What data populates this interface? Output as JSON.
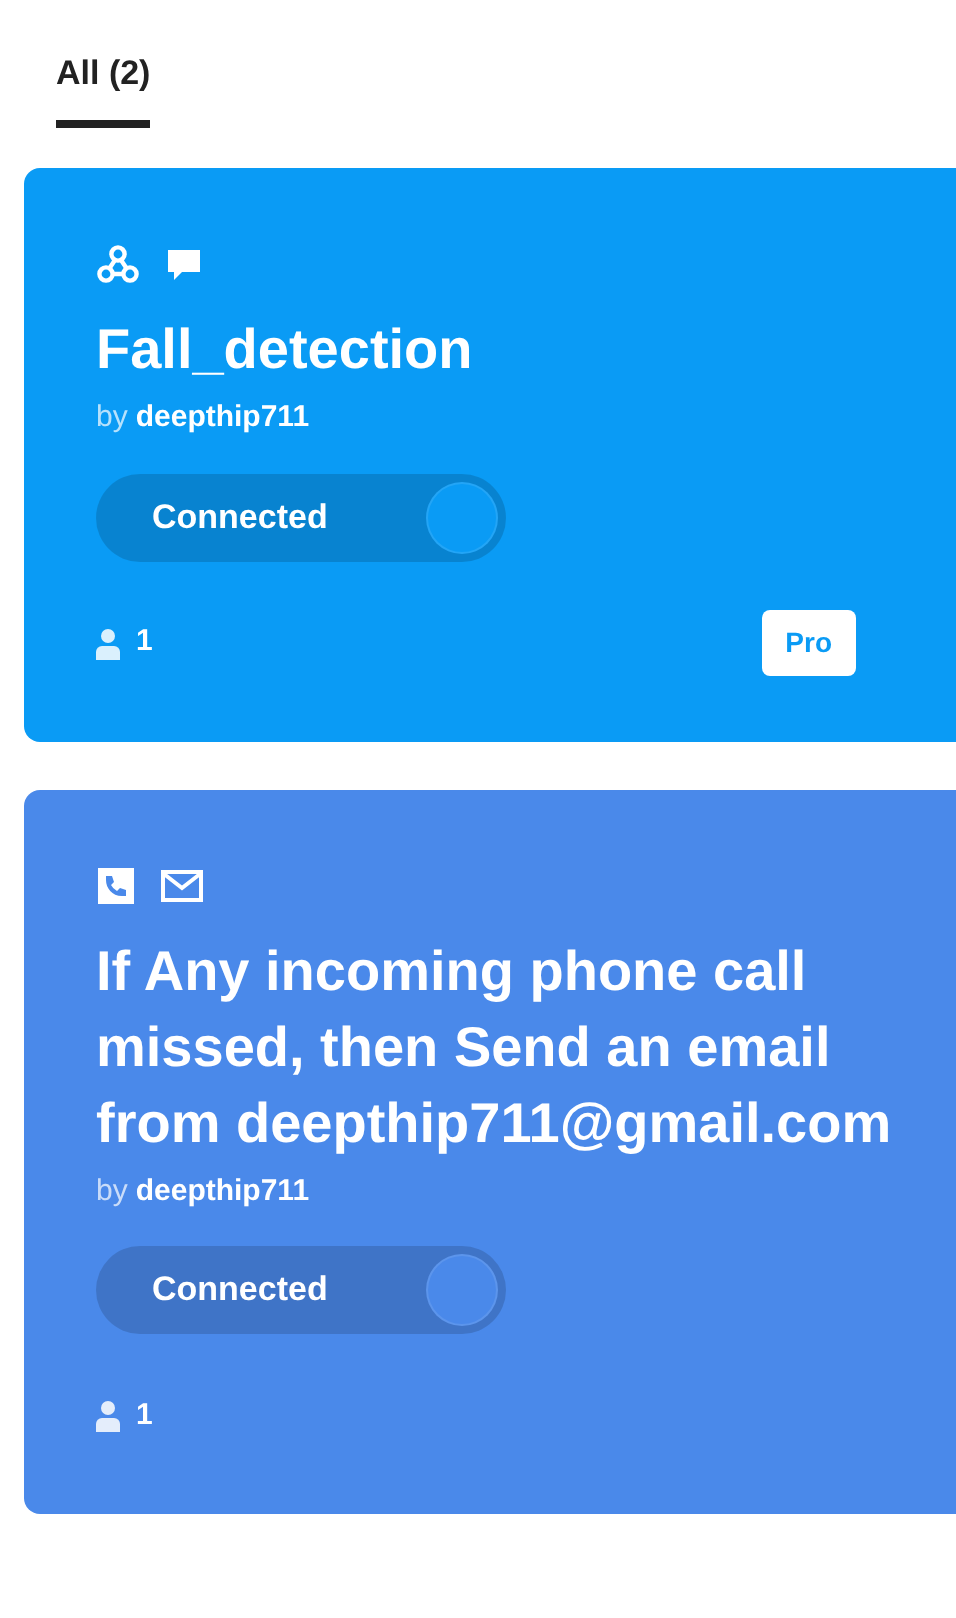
{
  "tabs": [
    {
      "label": "All (2)",
      "selected": true
    }
  ],
  "applets": [
    {
      "color": "#0a9bf5",
      "icons": [
        {
          "kind": "webhooks"
        },
        {
          "kind": "chat"
        }
      ],
      "title": "Fall_detection",
      "by": "by",
      "author": "deepthip711",
      "toggle": {
        "label": "Connected",
        "on": true
      },
      "users": "1",
      "badge": "Pro"
    },
    {
      "color": "#4a89ea",
      "icons": [
        {
          "kind": "phone"
        },
        {
          "kind": "mail"
        }
      ],
      "title": "If Any incoming phone call missed, then Send an email from deepthip711@gmail.com",
      "by": "by",
      "author": "deepthip711",
      "toggle": {
        "label": "Connected",
        "on": true
      },
      "users": "1"
    }
  ]
}
